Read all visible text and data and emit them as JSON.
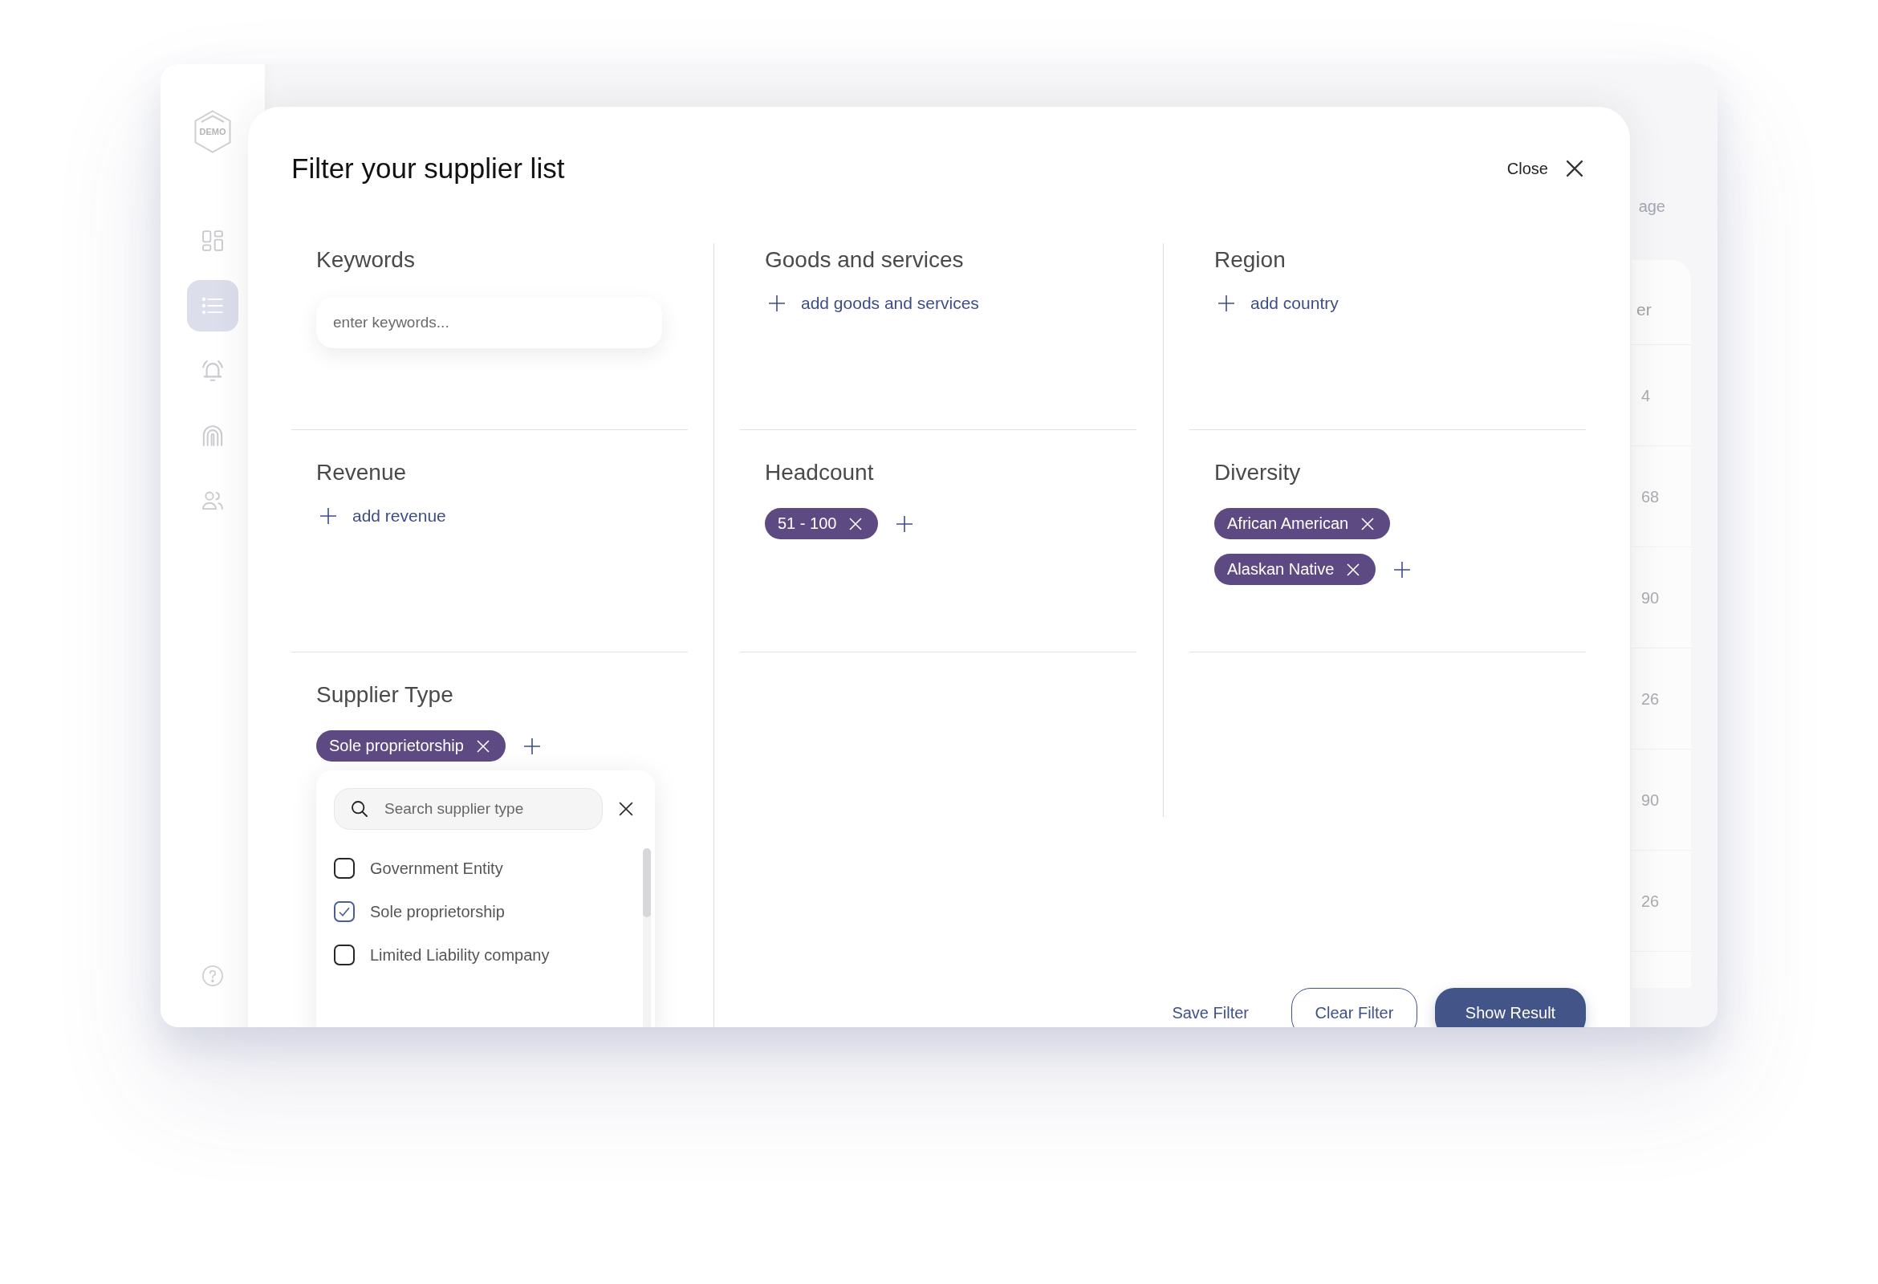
{
  "sidebar": {
    "logo": "DEMO",
    "items": [
      {
        "selected": false
      },
      {
        "selected": true
      },
      {
        "selected": false
      },
      {
        "selected": false
      },
      {
        "selected": false
      }
    ]
  },
  "background": {
    "label": "age",
    "table": {
      "columns": [
        "er"
      ],
      "rows": [
        [
          "4"
        ],
        [
          "68"
        ],
        [
          "90"
        ],
        [
          "26"
        ],
        [
          "90"
        ],
        [
          "26"
        ]
      ]
    }
  },
  "modal": {
    "title": "Filter your supplier list",
    "close_label": "Close",
    "sections": [
      {
        "kind": "input",
        "title": "Keywords",
        "placeholder": "enter keywords..."
      },
      {
        "kind": "add",
        "title": "Goods and services",
        "add_label": "add goods and services"
      },
      {
        "kind": "add",
        "title": "Region",
        "add_label": "add country"
      },
      {
        "kind": "add",
        "title": "Revenue",
        "add_label": "add revenue"
      },
      {
        "kind": "tags",
        "title": "Headcount",
        "tags": [
          "51 - 100"
        ]
      },
      {
        "kind": "tags",
        "title": "Diversity",
        "tags": [
          "African American",
          "Alaskan Native"
        ]
      },
      {
        "kind": "tags",
        "title": "Supplier Type",
        "tags": [
          "Sole proprietorship"
        ],
        "dropdown": {
          "placeholder": "Search supplier type",
          "options": [
            {
              "label": "Government Entity",
              "checked": false
            },
            {
              "label": "Sole proprietorship",
              "checked": true
            },
            {
              "label": "Limited Liability company",
              "checked": false
            }
          ]
        }
      }
    ],
    "footer": [
      {
        "kind": "link",
        "label": "Save Filter"
      },
      {
        "kind": "outline",
        "label": "Clear Filter"
      },
      {
        "kind": "primary",
        "label": "Show Result"
      }
    ]
  }
}
